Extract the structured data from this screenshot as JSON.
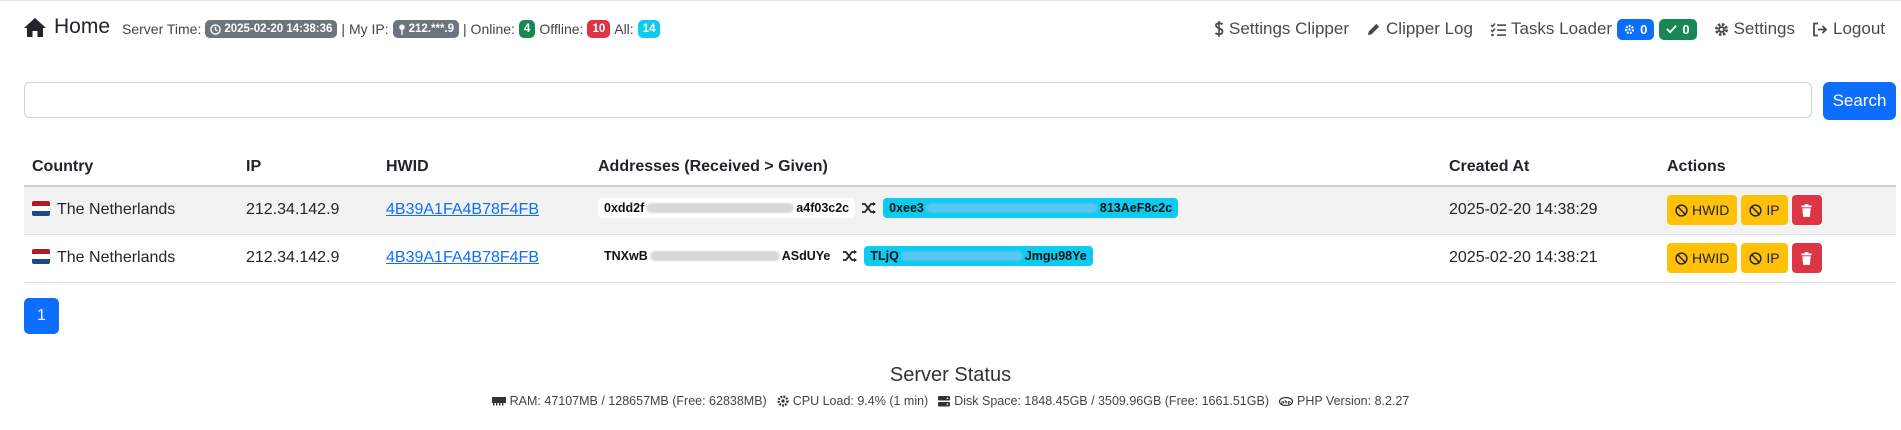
{
  "header": {
    "home_label": "Home",
    "server_time_label": "Server Time:",
    "server_time": "2025-02-20 14:38:36",
    "my_ip_label": "| My IP:",
    "my_ip": "212.***.9",
    "online_label": "| Online:",
    "online_count": "4",
    "offline_label": "Offline:",
    "offline_count": "10",
    "all_label": "All:",
    "all_count": "14"
  },
  "nav": {
    "settings_clipper": "Settings Clipper",
    "clipper_log": "Clipper Log",
    "tasks_loader": "Tasks Loader",
    "tasks_running": "0",
    "tasks_done": "0",
    "settings": "Settings",
    "logout": "Logout"
  },
  "search": {
    "value": "",
    "placeholder": "",
    "button_label": "Search"
  },
  "table": {
    "headers": {
      "country": "Country",
      "ip": "IP",
      "hwid": "HWID",
      "addresses": "Addresses (Received > Given)",
      "created_at": "Created At",
      "actions": "Actions"
    },
    "rows": [
      {
        "country": "The Netherlands",
        "ip": "212.34.142.9",
        "hwid": "4B39A1FA4B78F4FB",
        "received_start": "0xdd2f",
        "received_end": "a4f03c2c",
        "given_start": "0xee3",
        "given_end": "813AeF8c2c",
        "created_at": "2025-02-20 14:38:29"
      },
      {
        "country": "The Netherlands",
        "ip": "212.34.142.9",
        "hwid": "4B39A1FA4B78F4FB",
        "received_start": "TNXwB",
        "received_end": "ASdUYe",
        "given_start": "TLjQ",
        "given_end": "Jmgu98Ye",
        "created_at": "2025-02-20 14:38:21"
      }
    ],
    "action_labels": {
      "ban_hwid": "HWID",
      "ban_ip": "IP"
    }
  },
  "pagination": {
    "current_page": "1"
  },
  "status": {
    "title": "Server Status",
    "ram": "RAM: 47107MB / 128657MB (Free: 62838MB)",
    "cpu": "CPU Load: 9.4% (1 min)",
    "disk": "Disk Space: 1848.45GB / 3509.96GB (Free: 1661.51GB)",
    "php": "PHP Version: 8.2.27"
  },
  "colors": {
    "primary": "#0d6efd",
    "success": "#198754",
    "danger": "#dc3545",
    "info": "#0dcaf0",
    "warning": "#ffc107",
    "secondary": "#6c757d"
  }
}
